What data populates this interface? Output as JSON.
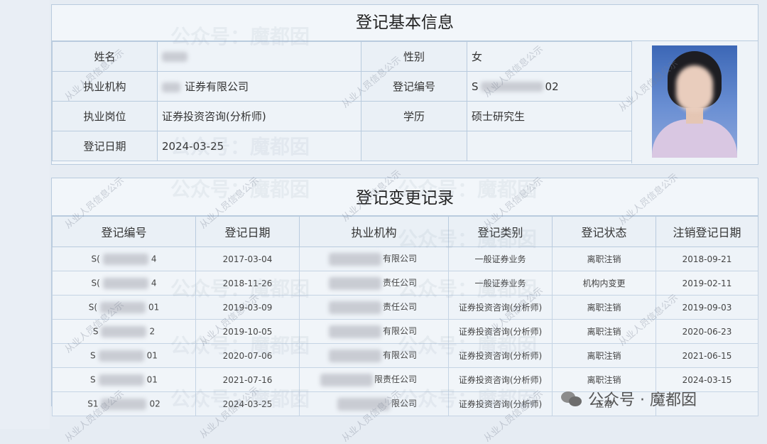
{
  "basic": {
    "title": "登记基本信息",
    "name_label": "姓名",
    "gender_label": "性别",
    "gender_value": "女",
    "org_label": "执业机构",
    "org_value_suffix": "证券有限公司",
    "regno_label": "登记编号",
    "regno_value_prefix": "S",
    "regno_value_suffix": "02",
    "position_label": "执业岗位",
    "position_value": "证券投资咨询(分析师)",
    "education_label": "学历",
    "education_value": "硕士研究生",
    "regdate_label": "登记日期",
    "regdate_value": "2024-03-25"
  },
  "changes": {
    "title": "登记变更记录",
    "headers": [
      "登记编号",
      "登记日期",
      "执业机构",
      "登记类别",
      "登记状态",
      "注销登记日期"
    ],
    "rows": [
      {
        "id_prefix": "S(",
        "id_suffix": "4",
        "date": "2017-03-04",
        "org_suffix": "有限公司",
        "category": "一般证券业务",
        "status": "离职注销",
        "cancel_date": "2018-09-21"
      },
      {
        "id_prefix": "S(",
        "id_suffix": "4",
        "date": "2018-11-26",
        "org_suffix": "责任公司",
        "category": "一般证券业务",
        "status": "机构内变更",
        "cancel_date": "2019-02-11"
      },
      {
        "id_prefix": "S(",
        "id_suffix": "01",
        "date": "2019-03-09",
        "org_suffix": "责任公司",
        "category": "证券投资咨询(分析师)",
        "status": "离职注销",
        "cancel_date": "2019-09-03"
      },
      {
        "id_prefix": "S",
        "id_suffix": "2",
        "date": "2019-10-05",
        "org_suffix": "有限公司",
        "category": "证券投资咨询(分析师)",
        "status": "离职注销",
        "cancel_date": "2020-06-23"
      },
      {
        "id_prefix": "S",
        "id_suffix": "01",
        "date": "2020-07-06",
        "org_suffix": "有限公司",
        "category": "证券投资咨询(分析师)",
        "status": "离职注销",
        "cancel_date": "2021-06-15"
      },
      {
        "id_prefix": "S",
        "id_suffix": "01",
        "date": "2021-07-16",
        "org_suffix": "限责任公司",
        "category": "证券投资咨询(分析师)",
        "status": "离职注销",
        "cancel_date": "2024-03-15"
      },
      {
        "id_prefix": "S1",
        "id_suffix": "02",
        "date": "2024-03-25",
        "org_suffix": "限公司",
        "category": "证券投资咨询(分析师)",
        "status": "正常",
        "cancel_date": ""
      }
    ]
  },
  "watermarks": {
    "large": "公众号：魔都囡",
    "diagonal": "从业人员信息公示"
  },
  "footer": {
    "text": "公众号 · 魔都囡",
    "icon": "wechat-icon"
  }
}
